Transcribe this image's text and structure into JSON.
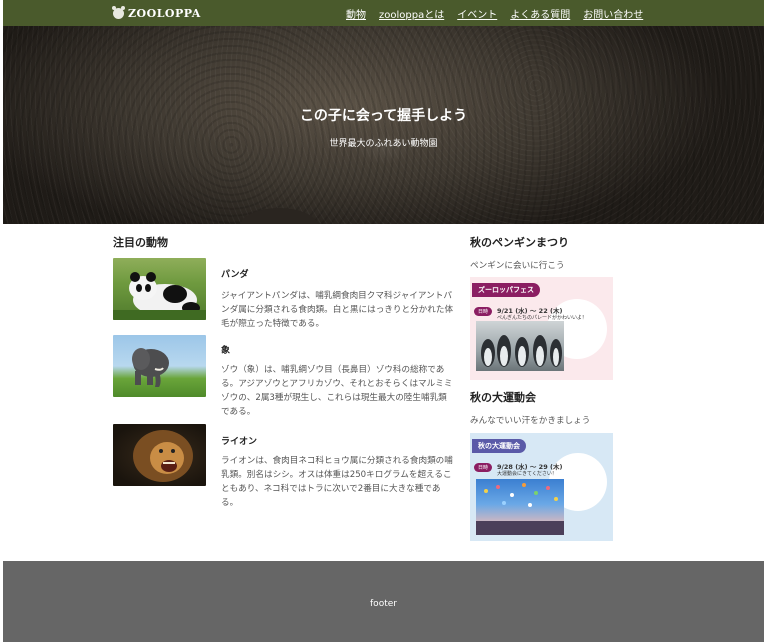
{
  "header": {
    "logo_text": "ZOOLOPPA",
    "nav": [
      "動物",
      "zooloppaとは",
      "イベント",
      "よくある質問",
      "お問い合わせ"
    ]
  },
  "hero": {
    "title": "この子に会って握手しよう",
    "subtitle": "世界最大のふれあい動物園"
  },
  "featured": {
    "title": "注目の動物",
    "animals": [
      {
        "name": "パンダ",
        "desc": "ジャイアントパンダは、哺乳綱食肉目クマ科ジャイアントパンダ属に分類される食肉類。白と黒にはっきりと分かれた体毛が際立った特徴である。"
      },
      {
        "name": "象",
        "desc": "ゾウ（象）は、哺乳綱ゾウ目（長鼻目）ゾウ科の総称である。アジアゾウとアフリカゾウ、それとおそらくはマルミミゾウの、2属3種が現生し、これらは現生最大の陸生哺乳類である。"
      },
      {
        "name": "ライオン",
        "desc": "ライオンは、食肉目ネコ科ヒョウ属に分類される食肉類の哺乳類。別名はシシ。オスは体重は250キログラムを超えることもあり、ネコ科ではトラに次いで2番目に大きな種である。"
      }
    ]
  },
  "events": [
    {
      "title": "秋のペンギンまつり",
      "subtitle": "ペンギンに会いに行こう",
      "banner_tag": "ズーロッパフェス",
      "banner_date_label": "日時",
      "banner_date": "9/21 (水) ～ 22 (木)",
      "banner_caption": "ぺんぎんたちのパレードがかわいいよ！"
    },
    {
      "title": "秋の大運動会",
      "subtitle": "みんなでいい汗をかきましょう",
      "banner_tag": "秋の大運動会",
      "banner_date_label": "日時",
      "banner_date": "9/28 (水) ～ 29 (木)",
      "banner_caption": "大運動会にきてください！"
    }
  ],
  "footer": {
    "text": "footer"
  },
  "colors": {
    "header_bg": "#4a5a2c",
    "footer_bg": "#666666",
    "penguin_banner_bg": "#fbe9ec",
    "penguin_tag": "#8b1e62",
    "sports_banner_bg": "#d7e8f5",
    "sports_tag": "#5a5aa8"
  }
}
